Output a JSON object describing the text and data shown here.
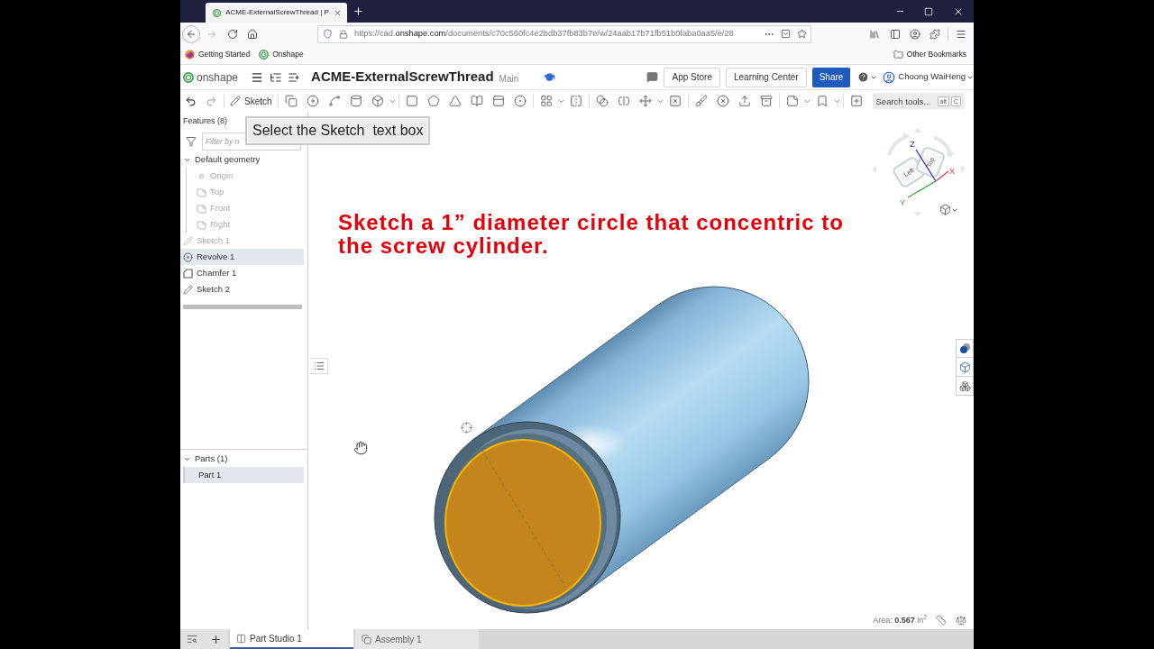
{
  "browser": {
    "tab": {
      "title": "ACME-ExternalScrewThread | P"
    },
    "url": {
      "scheme": "https://cad.",
      "domain": "onshape.com",
      "path": "/documents/c70c560fc4e2bdb37fb83b7e/w/24aab17b71fb51b0faba0aa5/e/28"
    },
    "bookmarks": [
      {
        "label": "Getting Started",
        "kind": "browser"
      },
      {
        "label": "Onshape",
        "kind": "app"
      }
    ],
    "other_bookmarks": "Other Bookmarks"
  },
  "app_header": {
    "logo": "onshape",
    "document_title": "ACME-ExternalScrewThread",
    "branch": "Main",
    "buttons": [
      {
        "label": "App Store",
        "kind": "plain"
      },
      {
        "label": "Learning Center",
        "kind": "plain"
      },
      {
        "label": "Share",
        "kind": "primary"
      }
    ],
    "user": "Choong WaiHeng"
  },
  "toolbar": {
    "sketch": "Sketch",
    "search": {
      "placeholder": "Search tools...",
      "keys": [
        "alt",
        "C"
      ]
    }
  },
  "tutorial_callout": "Select the Sketch  text box",
  "feature_panel": {
    "title": "Features (8)",
    "filter": {
      "placeholder": "Filter by n"
    },
    "tree": [
      {
        "label": "Default geometry",
        "kind": "folder",
        "expanded": true,
        "selected": false,
        "dimmed": false,
        "children": [
          {
            "label": "Origin",
            "kind": "origin",
            "selected": false,
            "dimmed": true
          },
          {
            "label": "Top",
            "kind": "plane",
            "selected": false,
            "dimmed": true
          },
          {
            "label": "Front",
            "kind": "plane",
            "selected": false,
            "dimmed": true
          },
          {
            "label": "Right",
            "kind": "plane",
            "selected": false,
            "dimmed": true
          }
        ]
      },
      {
        "label": "Sketch 1",
        "kind": "sketch",
        "selected": false,
        "dimmed": true
      },
      {
        "label": "Revolve 1",
        "kind": "revolve",
        "selected": true,
        "dimmed": false
      },
      {
        "label": "Chamfer 1",
        "kind": "chamfer",
        "selected": false,
        "dimmed": false
      },
      {
        "label": "Sketch 2",
        "kind": "sketch",
        "selected": false,
        "dimmed": false
      }
    ],
    "parts": {
      "title": "Parts (1)",
      "expanded": true,
      "items": [
        {
          "label": "Part 1",
          "selected": true
        }
      ]
    }
  },
  "viewport": {
    "annotation": "Sketch a 1” diameter circle that concentric to the screw cylinder.",
    "view_cube": {
      "faces": [
        "Left",
        "Top"
      ],
      "axes": [
        {
          "label": "Z",
          "color": "#2b2bb0"
        },
        {
          "label": "X",
          "color": "#e03a3a"
        },
        {
          "label": "Y",
          "color": "#3a9e3a"
        }
      ]
    },
    "area": "Area: **0.567** in$^{2}$"
  },
  "bottom_tabs": [
    {
      "label": "Part Studio 1",
      "kind": "part_studio",
      "selected": true
    },
    {
      "label": "Assembly 1",
      "kind": "assembly",
      "selected": false
    }
  ]
}
